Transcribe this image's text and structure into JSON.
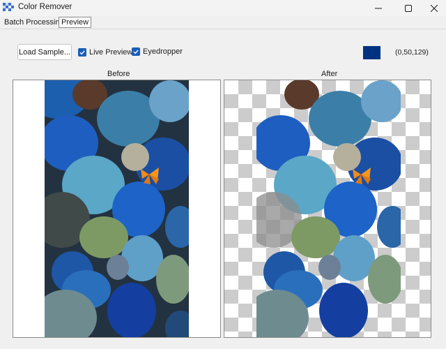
{
  "window": {
    "title": "Color Remover",
    "app_icon": "checkerboard-icon",
    "controls": [
      "minimize-icon",
      "maximize-icon",
      "close-icon"
    ]
  },
  "tabs": [
    {
      "label": "Batch Processing",
      "selected": false
    },
    {
      "label": "Preview",
      "selected": true
    }
  ],
  "toolbar": {
    "load_sample_label": "Load Sample...",
    "live_preview": {
      "label": "Live Preview",
      "checked": true
    },
    "eyedropper": {
      "label": "Eyedropper",
      "checked": true
    },
    "selected_color": "#003281",
    "selected_color_text": "(0,50,129)"
  },
  "panels": {
    "before_label": "Before",
    "after_label": "After"
  },
  "colors": {
    "accent": "#1a5eb8",
    "checker_dark": "#cccccc",
    "checker_light": "#ffffff"
  }
}
